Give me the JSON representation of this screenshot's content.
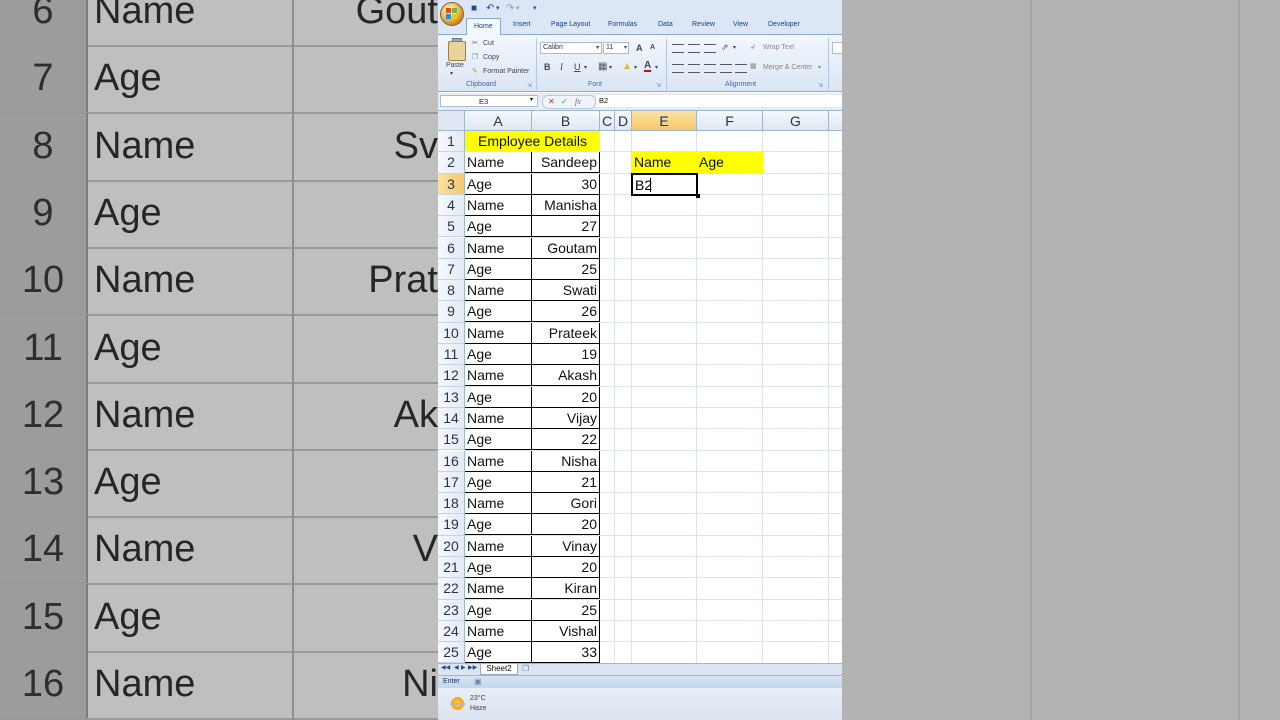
{
  "background_zoom": {
    "rows": [
      {
        "num": "6",
        "a": "Name",
        "b": "Gout"
      },
      {
        "num": "7",
        "a": "Age",
        "b": ""
      },
      {
        "num": "8",
        "a": "Name",
        "b": "Sv"
      },
      {
        "num": "9",
        "a": "Age",
        "b": ""
      },
      {
        "num": "10",
        "a": "Name",
        "b": "Prat"
      },
      {
        "num": "11",
        "a": "Age",
        "b": ""
      },
      {
        "num": "12",
        "a": "Name",
        "b": "Ak"
      },
      {
        "num": "13",
        "a": "Age",
        "b": ""
      },
      {
        "num": "14",
        "a": "Name",
        "b": "V"
      },
      {
        "num": "15",
        "a": "Age",
        "b": ""
      },
      {
        "num": "16",
        "a": "Name",
        "b": "Ni"
      }
    ]
  },
  "ribbon": {
    "tabs": [
      "Home",
      "Insert",
      "Page Layout",
      "Formulas",
      "Data",
      "Review",
      "View",
      "Developer"
    ],
    "active_tab": "Home",
    "clipboard": {
      "paste": "Paste",
      "cut": "Cut",
      "copy": "Copy",
      "format_painter": "Format Painter",
      "label": "Clipboard"
    },
    "font": {
      "name": "Calibri",
      "size": "11",
      "label": "Font",
      "bold": "B",
      "italic": "I",
      "underline": "U",
      "grow": "A",
      "shrink": "A",
      "font_color": "A"
    },
    "alignment": {
      "wrap_text": "Wrap Text",
      "merge_center": "Merge & Center",
      "label": "Alignment"
    }
  },
  "formula_bar": {
    "name_box": "E3",
    "fx": "fx",
    "content": "B2"
  },
  "grid": {
    "columns": [
      "A",
      "B",
      "C",
      "D",
      "E",
      "F",
      "G"
    ],
    "selected_column": "E",
    "selected_row": "3",
    "title": "Employee Details",
    "header_e": "Name",
    "header_f": "Age",
    "active_cell_value": "B2",
    "rows": [
      {
        "num": "1"
      },
      {
        "num": "2",
        "a": "Name",
        "b": "Sandeep"
      },
      {
        "num": "3",
        "a": "Age",
        "b": "30"
      },
      {
        "num": "4",
        "a": "Name",
        "b": "Manisha"
      },
      {
        "num": "5",
        "a": "Age",
        "b": "27"
      },
      {
        "num": "6",
        "a": "Name",
        "b": "Goutam"
      },
      {
        "num": "7",
        "a": "Age",
        "b": "25"
      },
      {
        "num": "8",
        "a": "Name",
        "b": "Swati"
      },
      {
        "num": "9",
        "a": "Age",
        "b": "26"
      },
      {
        "num": "10",
        "a": "Name",
        "b": "Prateek"
      },
      {
        "num": "11",
        "a": "Age",
        "b": "19"
      },
      {
        "num": "12",
        "a": "Name",
        "b": "Akash"
      },
      {
        "num": "13",
        "a": "Age",
        "b": "20"
      },
      {
        "num": "14",
        "a": "Name",
        "b": "Vijay"
      },
      {
        "num": "15",
        "a": "Age",
        "b": "22"
      },
      {
        "num": "16",
        "a": "Name",
        "b": "Nisha"
      },
      {
        "num": "17",
        "a": "Age",
        "b": "21"
      },
      {
        "num": "18",
        "a": "Name",
        "b": "Gori"
      },
      {
        "num": "19",
        "a": "Age",
        "b": "20"
      },
      {
        "num": "20",
        "a": "Name",
        "b": "Vinay"
      },
      {
        "num": "21",
        "a": "Age",
        "b": "20"
      },
      {
        "num": "22",
        "a": "Name",
        "b": "Kiran"
      },
      {
        "num": "23",
        "a": "Age",
        "b": "25"
      },
      {
        "num": "24",
        "a": "Name",
        "b": "Vishal"
      },
      {
        "num": "25",
        "a": "Age",
        "b": "33"
      }
    ]
  },
  "sheet_tabs": {
    "active": "Sheet2"
  },
  "status_bar": {
    "mode": "Enter"
  },
  "weather": {
    "temp": "23°C",
    "condition": "Haze"
  },
  "colors": {
    "yellow": "#ffff00",
    "selection_header": "#f5c76a",
    "ribbon": "#dbe7f6"
  }
}
